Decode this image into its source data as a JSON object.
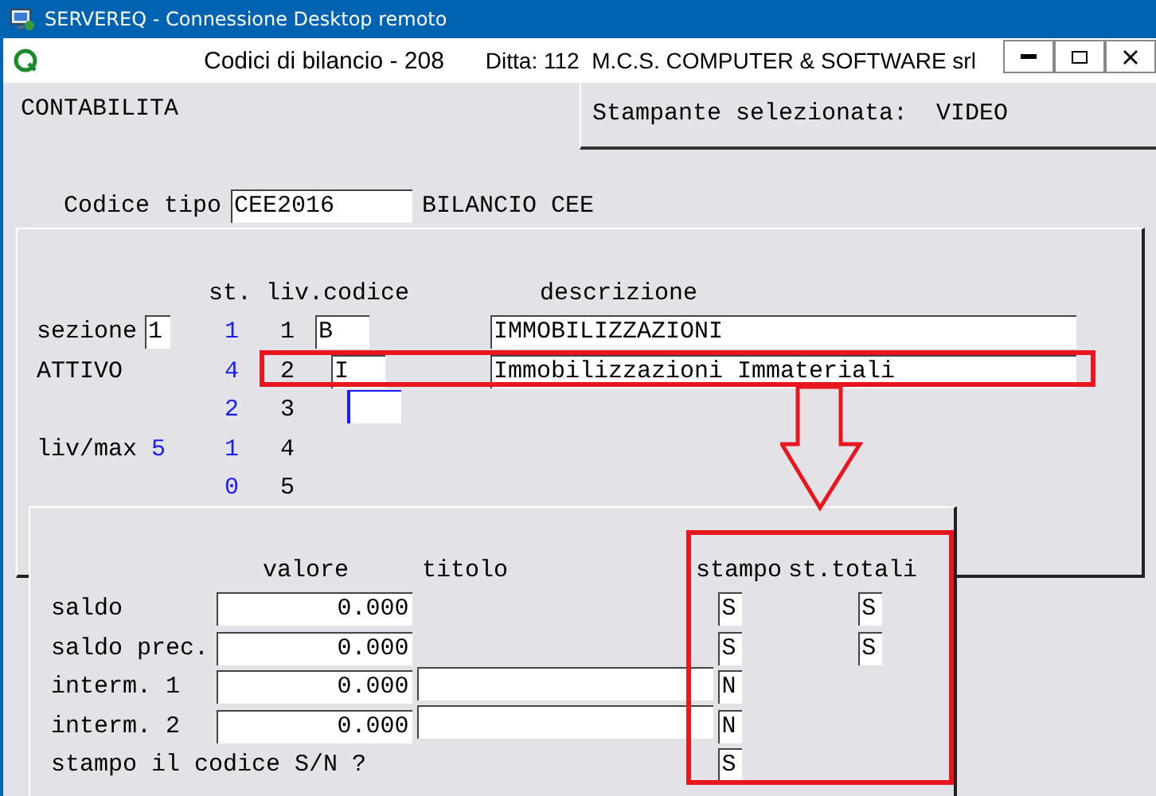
{
  "remote_window": {
    "title": "SERVEREQ - Connessione Desktop remoto"
  },
  "app_window": {
    "title": "Codici di bilancio - 208",
    "company": "Ditta: 112  M.C.S. COMPUTER & SOFTWARE srl"
  },
  "module": "CONTABILITA",
  "printer": {
    "label": "Stampante selezionata:",
    "value": "VIDEO"
  },
  "code_type": {
    "label": "Codice tipo",
    "value": "CEE2016",
    "description": "BILANCIO CEE"
  },
  "levels": {
    "headers": [
      "st.",
      "liv.codice",
      "descrizione"
    ],
    "section": {
      "label": "sezione",
      "value": "1",
      "name": "ATTIVO"
    },
    "max": {
      "label": "liv/max",
      "value": "5"
    },
    "rows": [
      {
        "st": "1",
        "liv": "1",
        "codice": {
          "value": "B",
          "focused": false
        },
        "descrizione": "IMMOBILIZZAZIONI"
      },
      {
        "st": "4",
        "liv": "2",
        "codice": {
          "value": "I",
          "focused": false
        },
        "descrizione": "Immobilizzazioni Immateriali"
      },
      {
        "st": "2",
        "liv": "3",
        "codice": {
          "focused": true
        }
      },
      {
        "st": "1",
        "liv": "4"
      },
      {
        "st": "0",
        "liv": "5"
      }
    ]
  },
  "values": {
    "headers": [
      "valore",
      "titolo",
      "stampo",
      "st.totali"
    ],
    "rows": [
      {
        "kind": "total",
        "label": "saldo",
        "valore": "0.000",
        "stampo": "S",
        "st_totali": "S"
      },
      {
        "kind": "total",
        "label": "saldo prec.",
        "valore": "0.000",
        "stampo": "S",
        "st_totali": "S"
      },
      {
        "kind": "intermediate",
        "label": "interm. 1",
        "valore": "0.000",
        "stampo": "N"
      },
      {
        "kind": "intermediate",
        "label": "interm. 2",
        "valore": "0.000",
        "stampo": "N"
      },
      {
        "kind": "question",
        "label": "stampo il codice S/N ?",
        "stampo": "S"
      }
    ]
  }
}
